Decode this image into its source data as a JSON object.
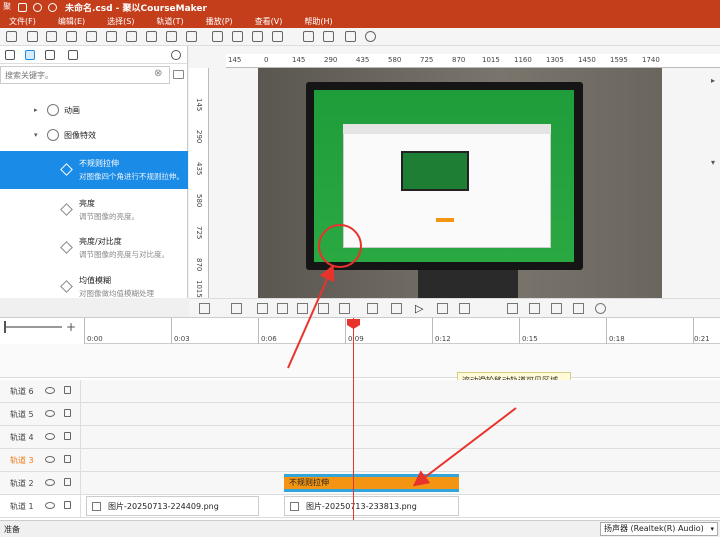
{
  "titlebar": {
    "logo": "聚",
    "title": "未命名.csd - 聚以CourseMaker"
  },
  "menu": [
    "文件(F)",
    "编辑(E)",
    "选择(S)",
    "轨道(T)",
    "播放(P)",
    "查看(V)",
    "帮助(H)"
  ],
  "left_panel": {
    "search_placeholder": "搜索关键字。",
    "tree": [
      {
        "label": "动画",
        "caret": "▸"
      },
      {
        "label": "图像特效",
        "caret": "▾"
      }
    ],
    "effects": [
      {
        "name": "不规则拉伸",
        "desc": "对图像四个角进行不规则拉伸。",
        "selected": true
      },
      {
        "name": "亮度",
        "desc": "调节图像的亮度。",
        "selected": false
      },
      {
        "name": "亮度/对比度",
        "desc": "调节图像的亮度与对比度。",
        "selected": false
      },
      {
        "name": "均值模糊",
        "desc": "对图像做均值模糊处理",
        "selected": false
      }
    ]
  },
  "preview": {
    "hruler": [
      "145",
      "0",
      "145",
      "290",
      "435",
      "580",
      "725",
      "870",
      "1015",
      "1160",
      "1305",
      "1450",
      "1595",
      "1740"
    ],
    "vruler": [
      "145",
      "290",
      "435",
      "580",
      "725",
      "870",
      "1015"
    ]
  },
  "timeline": {
    "ticks": [
      "0:00",
      "0:03",
      "0:06",
      "0:09",
      "0:12",
      "0:15",
      "0:18",
      "0:21"
    ],
    "tooltip": "滚动滑轮移动轨道可见区域。",
    "tracks": [
      {
        "name": "轨道 6",
        "highlight": false
      },
      {
        "name": "轨道 5",
        "highlight": false
      },
      {
        "name": "轨道 4",
        "highlight": false
      },
      {
        "name": "轨道 3",
        "highlight": true
      },
      {
        "name": "轨道 2",
        "highlight": false
      },
      {
        "name": "轨道 1",
        "highlight": false
      }
    ],
    "effect_clip_label": "不规则拉伸",
    "image_clips": [
      "图片-20250713-224409.png",
      "图片-20250713-233813.png"
    ]
  },
  "status": {
    "text": "准备",
    "audio_device": "扬声器 (Realtek(R) Audio)"
  },
  "colors": {
    "accent": "#c43e1c",
    "selection": "#1a8be6",
    "clip": "#f39512",
    "playhead": "#e8322c"
  }
}
